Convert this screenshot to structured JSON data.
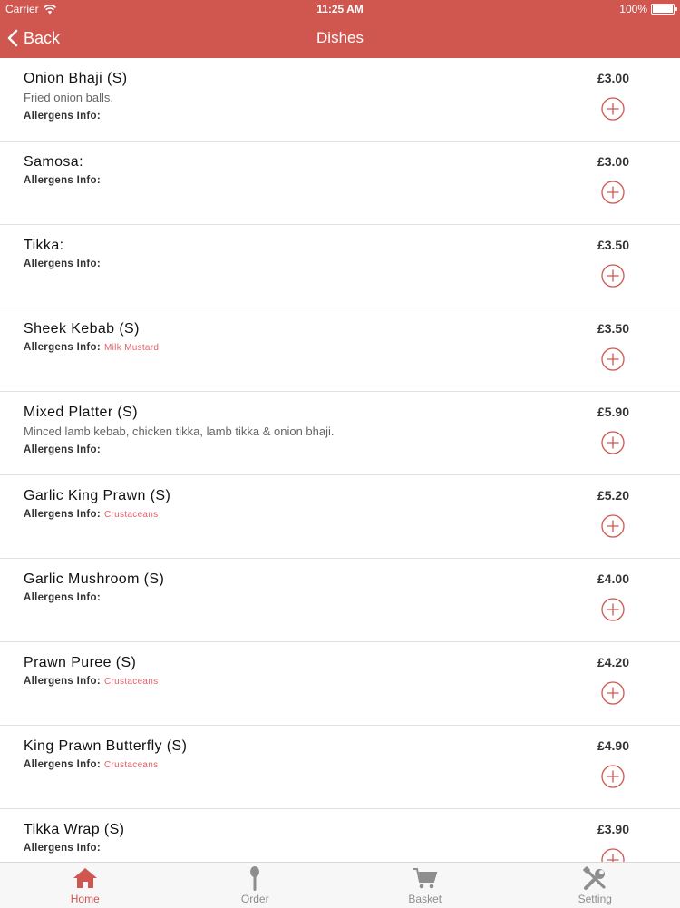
{
  "status_bar": {
    "carrier": "Carrier",
    "time": "11:25 AM",
    "battery": "100%"
  },
  "nav": {
    "back_label": "Back",
    "title": "Dishes"
  },
  "dishes": [
    {
      "name": "Onion Bhaji (S)",
      "description": "Fried onion balls.",
      "allergens_label": "Allergens Info:",
      "allergens": "",
      "price": "£3.00"
    },
    {
      "name": "Samosa:",
      "description": "",
      "allergens_label": "Allergens Info:",
      "allergens": "",
      "price": "£3.00"
    },
    {
      "name": "Tikka:",
      "description": "",
      "allergens_label": "Allergens Info:",
      "allergens": "",
      "price": "£3.50"
    },
    {
      "name": "Sheek Kebab (S)",
      "description": "",
      "allergens_label": "Allergens Info:",
      "allergens": "Milk  Mustard",
      "price": "£3.50"
    },
    {
      "name": "Mixed Platter (S)",
      "description": "Minced lamb kebab, chicken tikka, lamb tikka & onion bhaji.",
      "allergens_label": "Allergens Info:",
      "allergens": "",
      "price": "£5.90"
    },
    {
      "name": "Garlic King Prawn (S)",
      "description": "",
      "allergens_label": "Allergens Info:",
      "allergens": "Crustaceans",
      "price": "£5.20"
    },
    {
      "name": "Garlic Mushroom (S)",
      "description": "",
      "allergens_label": "Allergens Info:",
      "allergens": "",
      "price": "£4.00"
    },
    {
      "name": "Prawn Puree (S)",
      "description": "",
      "allergens_label": "Allergens Info:",
      "allergens": "Crustaceans",
      "price": "£4.20"
    },
    {
      "name": "King Prawn Butterfly (S)",
      "description": "",
      "allergens_label": "Allergens Info:",
      "allergens": "Crustaceans",
      "price": "£4.90"
    },
    {
      "name": "Tikka Wrap (S)",
      "description": "",
      "allergens_label": "Allergens Info:",
      "allergens": "",
      "price": "£3.90"
    }
  ],
  "tabs": [
    {
      "label": "Home",
      "icon": "home-icon",
      "active": true
    },
    {
      "label": "Order",
      "icon": "spoon-icon",
      "active": false
    },
    {
      "label": "Basket",
      "icon": "cart-icon",
      "active": false
    },
    {
      "label": "Setting",
      "icon": "tools-icon",
      "active": false
    }
  ],
  "colors": {
    "accent": "#cf5750",
    "allergen_tag": "#e4606b",
    "tab_inactive": "#8e8e8e"
  }
}
